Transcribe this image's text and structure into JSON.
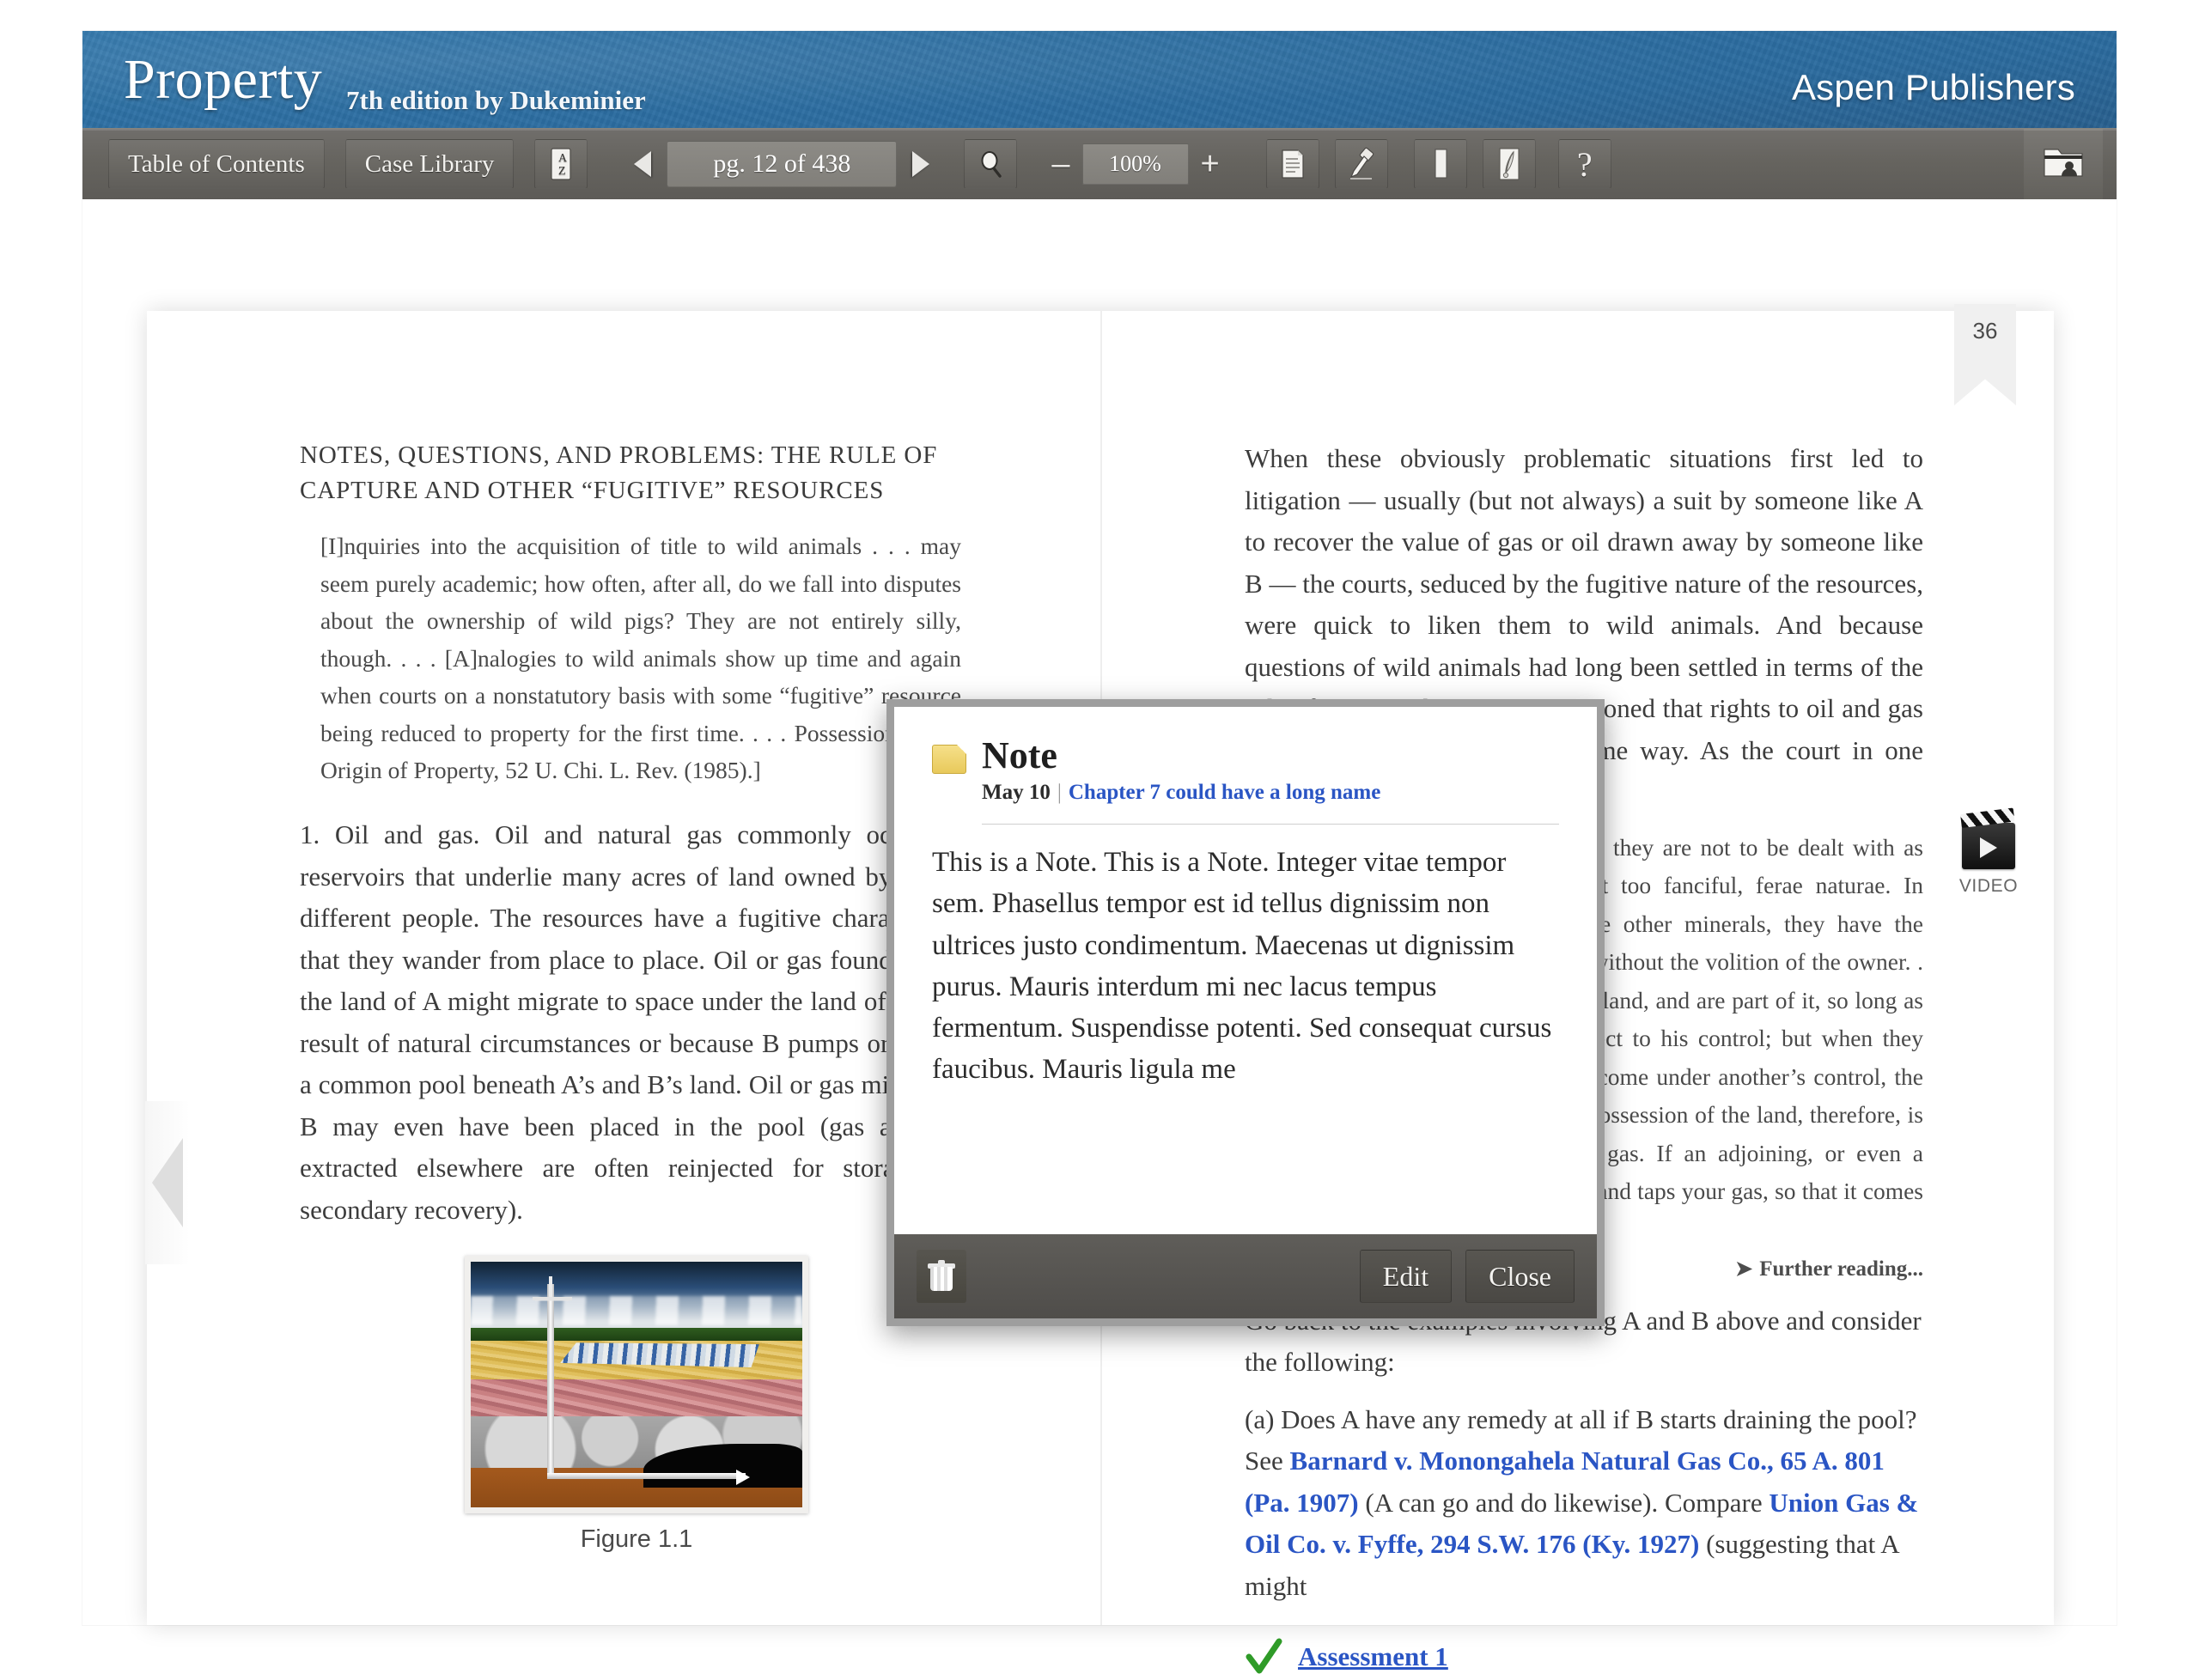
{
  "header": {
    "book_title": "Property",
    "book_subtitle": "7th edition by Dukeminier",
    "publisher": "Aspen Publishers",
    "brand_color": "#2d6fa3"
  },
  "toolbar": {
    "table_of_contents": "Table of Contents",
    "case_library": "Case Library",
    "az_icon_top": "A",
    "az_icon_bottom": "Z",
    "prev_page_icon": "triangle-left",
    "page_field": "pg. 12 of 438",
    "next_page_icon": "triangle-right",
    "search_icon": "magnifier",
    "zoom_out": "–",
    "zoom_value": "100%",
    "zoom_in": "+",
    "notes_icon": "document",
    "highlighter_icon": "highlighter-pen",
    "bookmark_icon": "bookmark",
    "quill_icon": "quill-note",
    "help_icon": "?",
    "account_icon": "user-folder"
  },
  "reader": {
    "bookmark_number": "36",
    "flip_left_icon": "chevron-left"
  },
  "left_page": {
    "section_heading": "NOTES, QUESTIONS, AND PROBLEMS: THE RULE OF CAPTURE AND OTHER “FUGITIVE” RESOURCES",
    "quote": "[I]nquiries into the acquisition of title to wild animals . . . may seem purely academic; how often, after all, do we fall into disputes about the ownership of wild pigs? They are not entirely silly, though. . . . [A]nalogies to wild animals show up time and again when courts on a nonstatutory basis with some “fugitive” resource being reduced to property for the first time. . . . Possession as the Origin of Property, 52 U. Chi. L. Rev. (1985).]",
    "paragraph": "1. Oil and gas. Oil and natural gas commonly occur in reservoirs that underlie many acres of land owned by many different people. The resources have a fugitive character in that they wander from place to place. Oil or gas found under the land of A might migrate to space under the land of B as a result of natural circumstances or because B pumps or mines a common pool beneath A’s and B’s land. Oil or gas mined by B may even have been placed in the pool (gas and oil extracted elsewhere are often reinjected for storage or secondary recovery).",
    "figure_caption": "Figure 1.1",
    "figure_alt": "oil-well-cross-section"
  },
  "right_page": {
    "paragraph_1": "When these obviously problematic situations first led to litigation — usually (but not always) a suit by someone like A to recover the value of gas or oil drawn away by someone like B — the courts, seduced by the fugitive nature of the resources, were quick to liken them to wild animals. And because questions of wild animals had long been settled in terms of the rule of capture, the courts reareasoned that rights to oil and gas should be determined in the same way. As the court in one early case said,",
    "quote": "[Oil and gas] are minerals . . . but they are not to be dealt with as themselves, if the analogy be not too fanciful, ferae naturae. In common with animals, and unlike other minerals, they have the power and the tendency to escape without the volition of the owner. . . . They belong to the owner of the land, and are part of it, so long as they are on or in it, and are subject to his control; but when they escape, and go into other land, or come under another’s control, the title of the former owner is gone. Possession of the land, therefore, is not necessarily possession of the gas. If an adjoining, or even a distant, owner, drills his own land, and taps your gas, so that it comes into his well and",
    "further_reading": "Further reading...",
    "paragraph_2": "Go back to the examples involving A and B above and consider the following:",
    "paragraph_3_prefix": "(a) Does A have any remedy at all if B starts draining the pool? See ",
    "case_link_1": "Barnard v. Monongahela Natural Gas Co., 65 A. 801 (Pa. 1907)",
    "paragraph_3_middle": " (A can go and do likewise). Compare ",
    "case_link_2": "Union Gas & Oil Co. v. Fyffe, 294 S.W. 176 (Ky. 1927)",
    "paragraph_3_suffix": " (suggesting that A might",
    "assessment_label": "Assessment 1",
    "assessment_icon": "green-check",
    "video_label": "VIDEO",
    "video_icon": "clapperboard"
  },
  "note_dialog": {
    "folder_icon": "yellow-note-folder",
    "title": "Note",
    "date": "May 10",
    "separator": "|",
    "chapter_link": "Chapter 7  could have a long name",
    "body": "This is a Note. This is a Note. Integer vitae tempor sem. Phasellus tempor est id tellus dignissim non ultrices justo condimentum. Maecenas ut dignissim purus. Mauris interdum mi nec lacus tempus fermentum. Suspendisse potenti. Sed consequat cursus faucibus. Mauris ligula me",
    "delete_icon": "trash-can",
    "edit_label": "Edit",
    "close_label": "Close",
    "link_color": "#2a55c4"
  }
}
